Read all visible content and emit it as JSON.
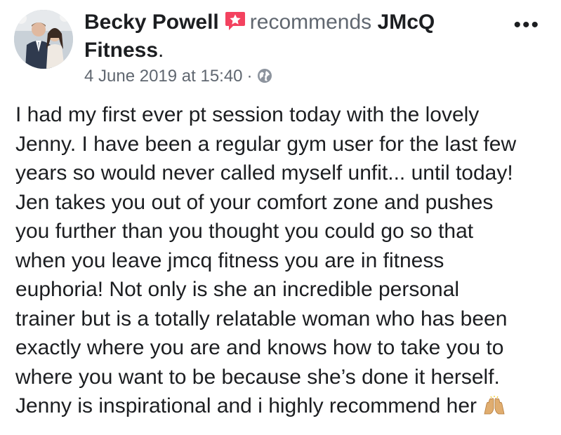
{
  "post": {
    "author_name": "Becky Powell",
    "verb": "recommends",
    "page_name_line1": "JMcQ",
    "page_name_line2": "Fitness",
    "page_name_period": ".",
    "timestamp": "4 June 2019 at 15:40",
    "separator": "·",
    "privacy_icon": "globe-icon",
    "recommend_icon": "recommendation-badge-icon",
    "more_label": "•••",
    "body_lines": [
      "I had my first ever pt session today with the lovely",
      "Jenny. I have been a regular gym user for the last few",
      "years so would never called myself unfit... until today!",
      "Jen takes you out of your comfort zone and pushes",
      "you further than you thought you could go so that",
      "when you leave jmcq fitness you are in fitness",
      "euphoria! Not only is she an incredible personal",
      "trainer but is a totally relatable woman who has been",
      "exactly where you are and knows how to take you to",
      "where you want to be because she’s done it herself.",
      "Jenny is inspirational and i highly recommend her"
    ],
    "trailing_emoji": "raising-hands-emoji"
  },
  "colors": {
    "text": "#1c1e21",
    "secondary_text": "#606770",
    "recommend_badge": "#f3425f",
    "background": "#ffffff"
  }
}
